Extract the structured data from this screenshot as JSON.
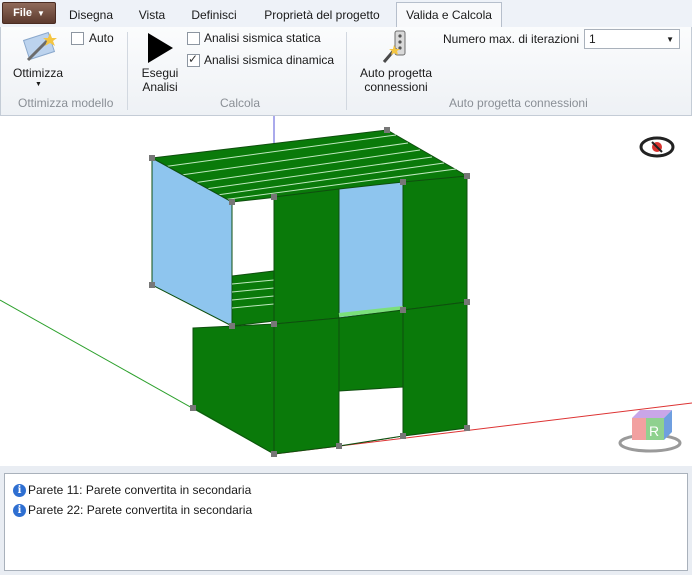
{
  "file_menu": {
    "label": "File"
  },
  "tabs": [
    {
      "label": "Disegna",
      "active": false
    },
    {
      "label": "Vista",
      "active": false
    },
    {
      "label": "Definisci",
      "active": false
    },
    {
      "label": "Proprietà del progetto",
      "active": false
    },
    {
      "label": "Valida e Calcola",
      "active": true
    }
  ],
  "ribbon": {
    "optimize": {
      "button_label": "Ottimizza",
      "auto_label": "Auto",
      "auto_checked": false,
      "group_label": "Ottimizza modello"
    },
    "calc": {
      "run_label_line1": "Esegui",
      "run_label_line2": "Analisi",
      "static_label": "Analisi sismica statica",
      "static_checked": false,
      "dynamic_label": "Analisi sismica dinamica",
      "dynamic_checked": true,
      "group_label": "Calcola"
    },
    "connections": {
      "button_line1": "Auto progetta",
      "button_line2": "connessioni",
      "iterations_label": "Numero max. di iterazioni",
      "iterations_value": "1",
      "group_label": "Auto progetta connessioni"
    }
  },
  "viewport": {
    "wall_color": "#0a7a0a",
    "selected_wall_color": "#8ec5ee",
    "eye_icon": "visibility-icon",
    "nav_cube_label": "R"
  },
  "messages": [
    {
      "icon": "info-icon",
      "text": "Parete 11: Parete convertita in secondaria"
    },
    {
      "icon": "info-icon",
      "text": "Parete 22: Parete convertita in secondaria"
    }
  ]
}
